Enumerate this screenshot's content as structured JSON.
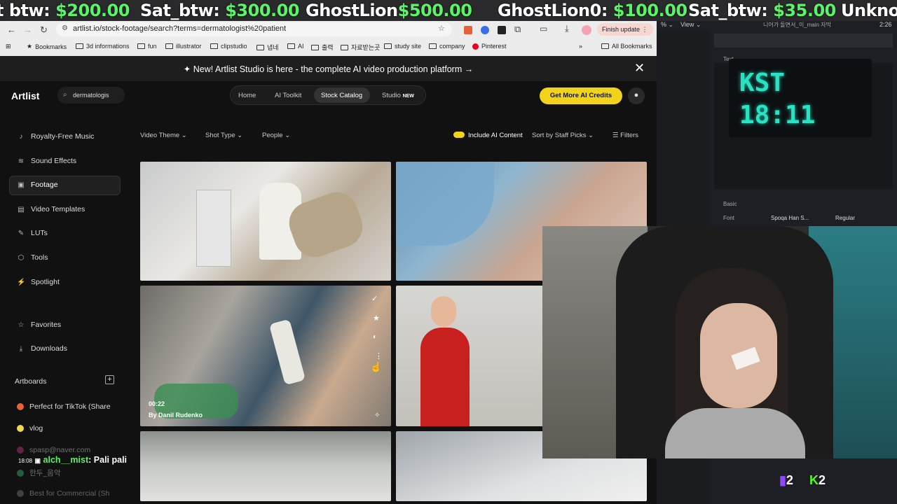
{
  "ticker": [
    {
      "prefix": "t btw: ",
      "amount": "$200.00"
    },
    {
      "prefix": "Sat_btw: ",
      "amount": "$300.00"
    },
    {
      "prefix": "GhostLion",
      "amount": "$500.00"
    },
    {
      "prefix": "GhostLion0: ",
      "amount": "$100.00"
    },
    {
      "prefix": "Sat_btw: ",
      "amount": "$35.00"
    },
    {
      "prefix": "Unkno",
      "amount": ""
    }
  ],
  "browser": {
    "url": "artlist.io/stock-footage/search?terms=dermatologist%20patient",
    "finish_update": "Finish update",
    "bookmarks": [
      "Bookmarks",
      "3d informations",
      "fun",
      "illustrator",
      "clipstudio",
      "냅네",
      "AI",
      "출력",
      "자료받는곳",
      "study site",
      "company",
      "Pinterest",
      "All Bookmarks"
    ]
  },
  "announcement": "New! Artlist Studio is here - the complete AI video production platform →",
  "header": {
    "logo": "Artlist",
    "search_value": "dermatologis",
    "nav": [
      "Home",
      "AI Toolkit",
      "Stock Catalog",
      "Studio"
    ],
    "studio_badge": "NEW",
    "credits_button": "Get More AI Credits"
  },
  "sidebar": {
    "items": [
      {
        "label": "Royalty-Free Music",
        "icon": "music-note-icon"
      },
      {
        "label": "Sound Effects",
        "icon": "waveform-icon"
      },
      {
        "label": "Footage",
        "icon": "film-icon"
      },
      {
        "label": "Video Templates",
        "icon": "template-icon"
      },
      {
        "label": "LUTs",
        "icon": "lut-icon"
      },
      {
        "label": "Tools",
        "icon": "tools-icon"
      },
      {
        "label": "Spotlight",
        "icon": "spotlight-icon"
      }
    ],
    "favorites": "Favorites",
    "downloads": "Downloads",
    "artboards_title": "Artboards",
    "artboards": [
      {
        "label": "Perfect for TikTok (Share",
        "color": "#e8623a"
      },
      {
        "label": "vlog",
        "color": "#f2d84b"
      },
      {
        "label": "spasp@naver.com",
        "color": "#c23a8c"
      },
      {
        "label": "한두_음악",
        "color": "#3ab87a"
      },
      {
        "label": "Best for Commercial (Sh",
        "color": "#888888"
      }
    ]
  },
  "filters": {
    "video_theme": "Video Theme",
    "shot_type": "Shot Type",
    "people": "People",
    "include_ai": "Include AI Content",
    "sort": "Sort by Staff Picks",
    "filters_btn": "Filters"
  },
  "clip_hover": {
    "duration": "00:22",
    "author": "By Danil Rudenko"
  },
  "obs": {
    "view_label": "View",
    "time_label": "2:26",
    "text_label": "Text",
    "basic_label": "Basic",
    "font_label": "Font",
    "font_value": "Spoqa Han S...",
    "font_style": "Regular",
    "clock_line1": "KST",
    "clock_line2": "18:11",
    "source_title": "니어가 돌면서_이_main 자막"
  },
  "chat": {
    "time": "18:08",
    "user": "alch__mist",
    "message": ": Pali pali"
  },
  "counters": {
    "twitch": "2",
    "kick": "2"
  }
}
